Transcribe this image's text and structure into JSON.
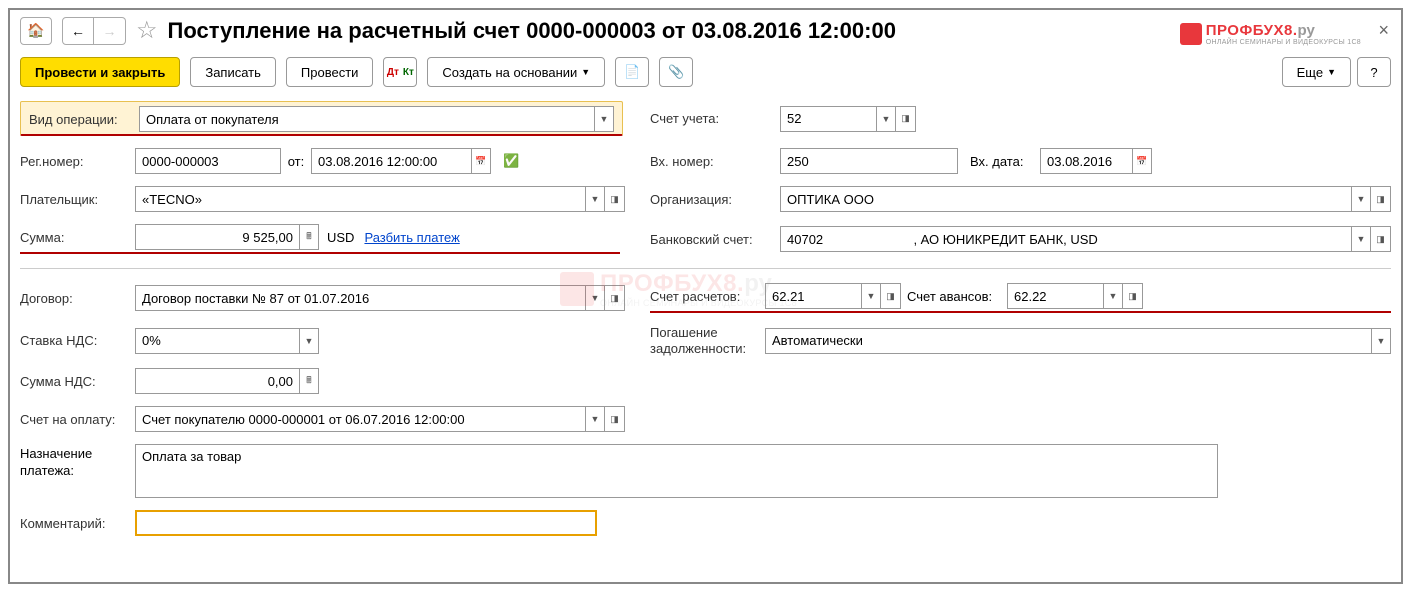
{
  "title": "Поступление на расчетный счет 0000-000003 от 03.08.2016 12:00:00",
  "logo": {
    "text": "ПРОФБУХ8.",
    "suffix": "ру",
    "sub": "ОНЛАЙН СЕМИНАРЫ И ВИДЕОКУРСЫ 1С8"
  },
  "toolbar": {
    "post_close": "Провести и закрыть",
    "save": "Записать",
    "post": "Провести",
    "create_based": "Создать на основании",
    "more": "Еще"
  },
  "labels": {
    "op_type": "Вид операции:",
    "reg_num": "Рег.номер:",
    "from": "от:",
    "payer": "Плательщик:",
    "sum": "Сумма:",
    "currency": "USD",
    "split": "Разбить платеж",
    "contract": "Договор:",
    "vat_rate": "Ставка НДС:",
    "vat_sum": "Сумма НДС:",
    "invoice": "Счет на оплату:",
    "purpose": "Назначение платежа:",
    "comment": "Комментарий:",
    "account": "Счет учета:",
    "in_num": "Вх. номер:",
    "in_date": "Вх. дата:",
    "org": "Организация:",
    "bank_acc": "Банковский счет:",
    "settle_acc": "Счет расчетов:",
    "advance_acc": "Счет авансов:",
    "debt": "Погашение задолженности:"
  },
  "values": {
    "op_type": "Оплата от покупателя",
    "reg_num": "0000-000003",
    "date": "03.08.2016 12:00:00",
    "payer": "«TECNO»",
    "sum": "9 525,00",
    "contract": "Договор поставки № 87 от 01.07.2016",
    "vat_rate": "0%",
    "vat_sum": "0,00",
    "invoice": "Счет покупателю 0000-000001 от 06.07.2016 12:00:00",
    "purpose": "Оплата за товар",
    "comment": "",
    "account": "52",
    "in_num": "250",
    "in_date": "03.08.2016",
    "org": "ОПТИКА ООО",
    "bank_acc": "40702                         , АО ЮНИКРЕДИТ БАНК, USD",
    "settle_acc": "62.21",
    "advance_acc": "62.22",
    "debt": "Автоматически"
  }
}
